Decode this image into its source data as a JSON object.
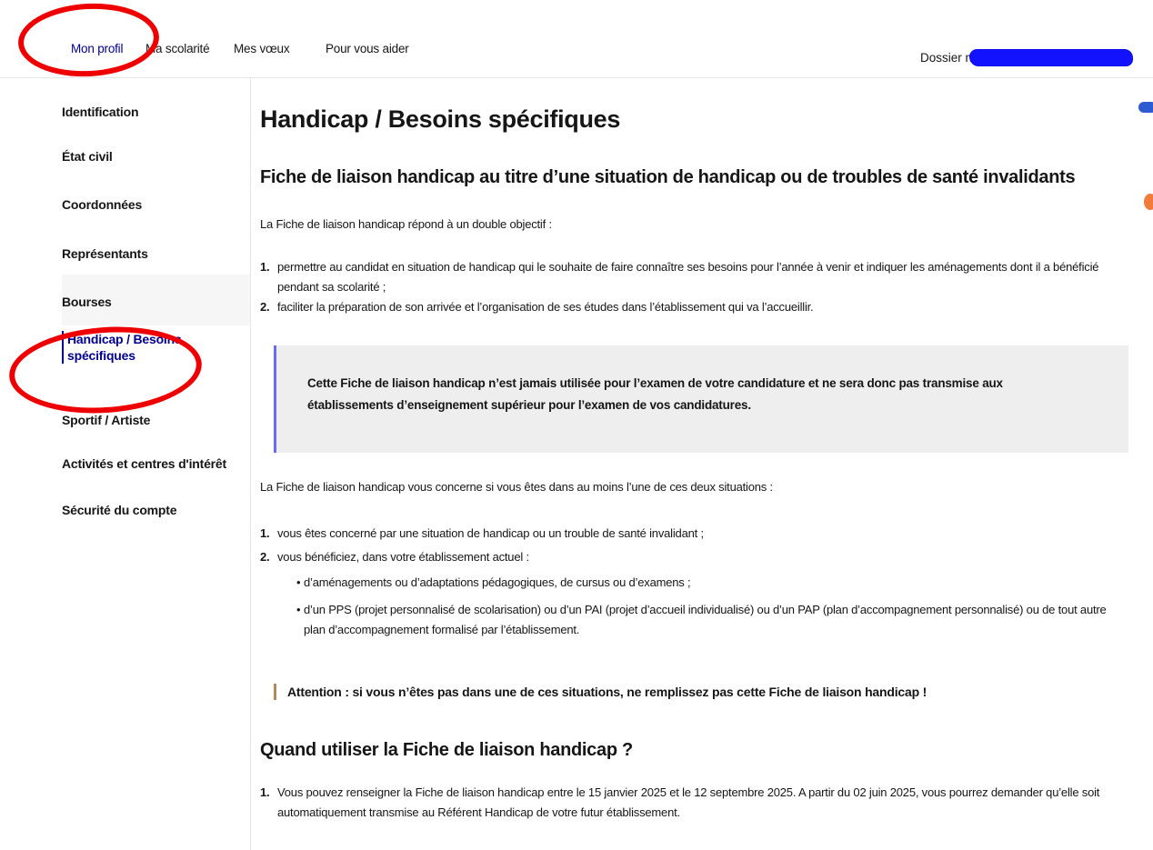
{
  "nav": {
    "items": [
      {
        "label": "Mon profil",
        "active": true
      },
      {
        "label": "Ma scolarité",
        "active": false
      },
      {
        "label": "Mes vœux",
        "active": false
      },
      {
        "label": "Pour vous aider",
        "active": false
      }
    ],
    "dossier_label": "Dossier n°"
  },
  "sidebar": {
    "items": [
      {
        "label": "Identification"
      },
      {
        "label": "État civil"
      },
      {
        "label": "Coordonnées"
      },
      {
        "label": "Représentants"
      },
      {
        "label": "Bourses"
      },
      {
        "label": "Handicap / Besoins spécifiques",
        "active": true
      },
      {
        "label": "Sportif / Artiste"
      },
      {
        "label": "Activités et centres d'intérêt"
      },
      {
        "label": "Sécurité du compte"
      }
    ]
  },
  "main": {
    "title": "Handicap / Besoins spécifiques",
    "subtitle": "Fiche de liaison handicap au titre d’une situation de handicap ou de troubles de santé invalidants",
    "intro": "La Fiche de liaison handicap répond à un double objectif :",
    "objectives": [
      "permettre au candidat en situation de handicap qui le souhaite de faire connaître ses besoins pour l’année à venir et indiquer les aménagements dont il a bénéficié pendant sa scolarité ;",
      "faciliter la préparation de son arrivée et l’organisation de ses études dans l’établissement qui va l’accueillir."
    ],
    "callout": "Cette Fiche de liaison handicap n’est jamais utilisée pour l’examen de votre candidature et ne sera donc pas transmise aux établissements d’enseignement supérieur pour l’examen de vos candidatures.",
    "concern_intro": "La Fiche de liaison handicap vous concerne si vous êtes dans au moins l’une de ces deux situations :",
    "situations": [
      "vous êtes concerné par une situation de handicap ou un trouble de santé invalidant ;",
      "vous bénéficiez, dans votre établissement actuel :"
    ],
    "situation_details": [
      "d’aménagements ou d’adaptations pédagogiques, de cursus ou d’examens ;",
      "d’un PPS (projet personnalisé de scolarisation) ou d’un PAI (projet d’accueil individualisé) ou d’un PAP (plan d’accompagnement personnalisé) ou de tout autre plan d’accompagnement formalisé par l’établissement."
    ],
    "attention": "Attention : si vous n’êtes pas dans une de ces situations, ne remplissez pas cette Fiche de liaison handicap !",
    "section_title": "Quand utiliser la Fiche de liaison handicap ?",
    "when": [
      "Vous pouvez renseigner la Fiche de liaison handicap entre le 15 janvier 2025 et le 12 septembre 2025. A partir du 02 juin 2025, vous pourrez demander qu’elle soit automatiquement transmise au Référent Handicap de votre futur établissement."
    ]
  },
  "colors": {
    "accent": "#000091",
    "annotation": "#ee0000",
    "redaction": "#1212ff",
    "callout_border": "#6a6af4",
    "attention_border": "#b08a5a"
  }
}
